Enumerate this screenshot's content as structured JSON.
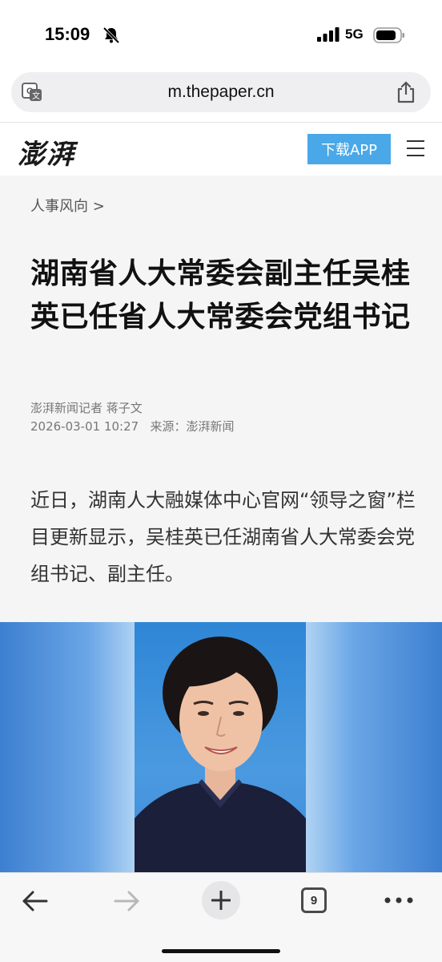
{
  "status": {
    "time": "15:09",
    "network": "5G"
  },
  "browser": {
    "url": "m.thepaper.cn"
  },
  "site": {
    "logo": "澎湃",
    "download_label": "下载APP"
  },
  "article": {
    "breadcrumb": "人事风向 >",
    "title": "湖南省人大常委会副主任吴桂英已任省人大常委会党组书记",
    "author": "澎湃新闻记者 蒋子文",
    "meta": "2026-03-01 10:27   来源：澎湃新闻",
    "lede": "近日，湖南人大融媒体中心官网“领导之窗”栏目更新显示，吴桂英已任湖南省人大常委会党组书记、副主任。"
  },
  "toolbar": {
    "tab_count": "9"
  }
}
